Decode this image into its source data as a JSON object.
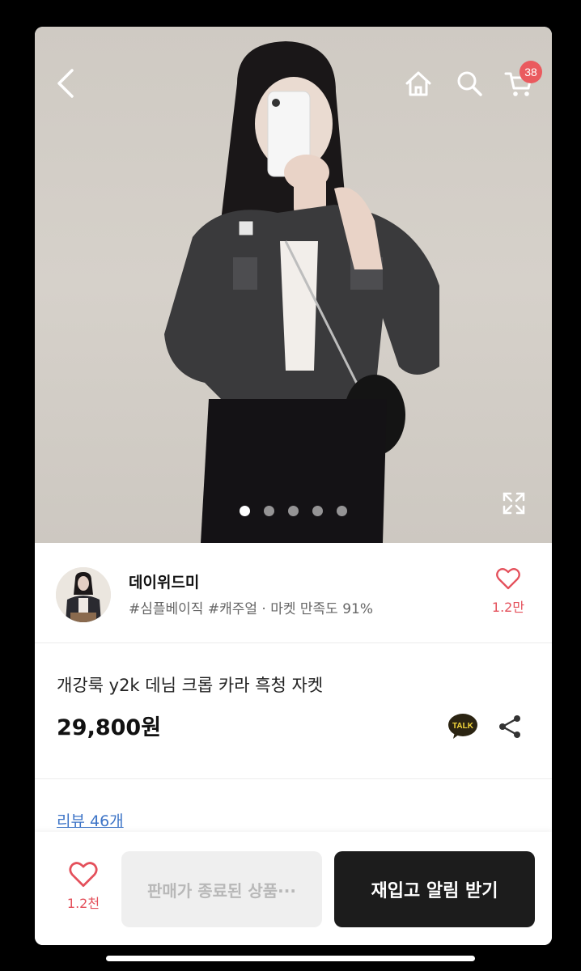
{
  "header": {
    "cart_count": "38"
  },
  "carousel": {
    "slides": 5,
    "active_index": 0
  },
  "seller": {
    "name": "데이위드미",
    "tags": "#심플베이직 #캐주얼 · 마켓 만족도 91%",
    "like_count": "1.2만"
  },
  "product": {
    "title": "개강룩 y2k 데님 크롭 카라 흑청 자켓",
    "price": "29,800원",
    "talk_label": "TALK"
  },
  "reviews": {
    "link": "리뷰 46개"
  },
  "bottom_bar": {
    "like_count": "1.2천",
    "sold_out_label": "판매가 종료된 상품···",
    "restock_label": "재입고 알림 받기"
  },
  "colors": {
    "accent_red": "#ea5a5e",
    "link_blue": "#3d74c7",
    "button_dark": "#1c1c1c"
  },
  "icons": [
    "back-icon",
    "home-icon",
    "search-icon",
    "cart-icon",
    "expand-icon",
    "heart-icon",
    "kakao-talk-icon",
    "share-icon"
  ]
}
